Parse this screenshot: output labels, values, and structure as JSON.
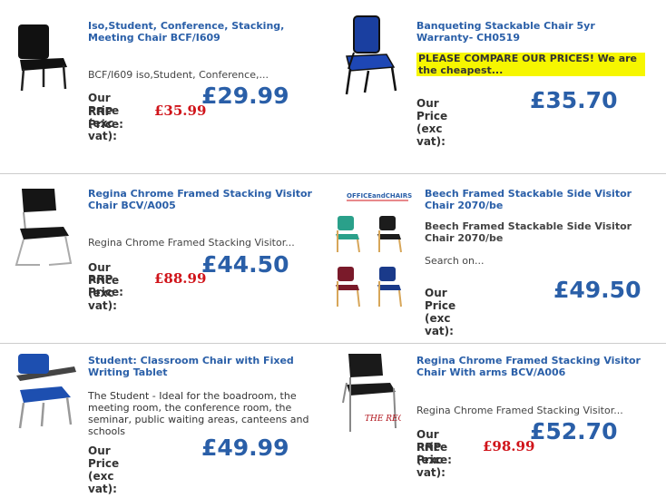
{
  "products": [
    {
      "title": "Iso,Student, Conference, Stacking, Meeting Chair BCF/I609",
      "description": "BCF/I609 iso,Student, Conference,...",
      "price_label": "Our Price (exc vat):",
      "price": "£29.99",
      "rrp_label": "RRP Price:",
      "rrp": "£35.99"
    },
    {
      "title": "Banqueting Stackable Chair 5yr Warranty- CH0519",
      "highlight": "PLEASE COMPARE OUR PRICES! We are the cheapest...",
      "price_label": "Our Price (exc vat):",
      "price": "£35.70"
    },
    {
      "title": "Regina Chrome Framed Stacking Visitor Chair BCV/A005",
      "description": "Regina Chrome Framed Stacking Visitor...",
      "price_label": "Our Price (exc vat):",
      "price": "£44.50",
      "rrp_label": "RRP Price:",
      "rrp": "£88.99"
    },
    {
      "title": "Beech Framed Stackable Side Visitor Chair 2070/be",
      "subtitle": "Beech Framed Stackable Side Visitor Chair 2070/be",
      "description": "Search on...",
      "price_label": "Our Price (exc vat):",
      "price": "£49.50",
      "logo_text": "OFFICEandCHAIRS"
    },
    {
      "title": "Student: Classroom Chair with Fixed Writing Tablet",
      "description": "The Student -  Ideal for the boadroom, the meeting room, the conference room, the seminar, public waiting areas, canteens and schools",
      "price_label": "Our Price (exc vat):",
      "price": "£49.99"
    },
    {
      "title": "Regina Chrome Framed Stacking Visitor Chair With arms BCV/A006",
      "description": "Regina Chrome Framed Stacking Visitor...",
      "price_label": "Our Price (exc vat):",
      "price": "£52.70",
      "rrp_label": "RRP Price:",
      "rrp": "£98.99",
      "image_text": "THE REGINA"
    }
  ],
  "colors": {
    "title_blue": "#2a5fa8",
    "rrp_red": "#d0141a",
    "highlight_yellow": "#f6f600"
  }
}
